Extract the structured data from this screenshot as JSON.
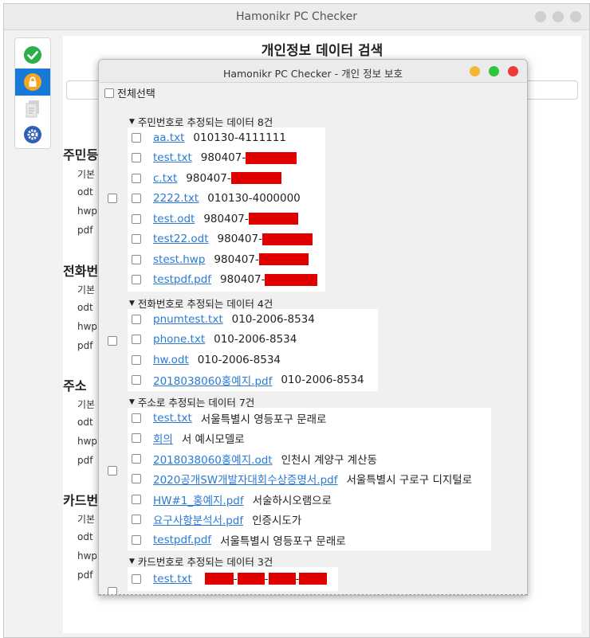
{
  "main_window": {
    "title": "Hamonikr PC Checker",
    "content_title": "개인정보 데이터 검색",
    "sections": [
      {
        "title": "주민등",
        "items": [
          "기본",
          "odt",
          "hwp",
          "pdf"
        ]
      },
      {
        "title": "전화번",
        "items": [
          "기본",
          "odt",
          "hwp",
          "pdf"
        ]
      },
      {
        "title": "주소",
        "items": [
          "기본",
          "odt",
          "hwp",
          "pdf"
        ]
      },
      {
        "title": "카드번",
        "items": [
          "기본",
          "odt",
          "hwp",
          "pdf"
        ]
      }
    ],
    "sidebar": [
      "check-icon",
      "lock-icon",
      "document-icon",
      "gear-icon"
    ]
  },
  "dialog": {
    "title": "Hamonikr PC Checker - 개인 정보 보호",
    "select_all": "전체선택",
    "groups": [
      {
        "header": "주민번호로 추정되는 데이터 8건",
        "rows": [
          {
            "file": "aa.txt",
            "value": "010130-4111111",
            "redacted": false
          },
          {
            "file": "test.txt",
            "value": "980407-",
            "redacted": true
          },
          {
            "file": "c.txt",
            "value": "980407-",
            "redacted": true
          },
          {
            "file": "2222.txt",
            "value": "010130-4000000",
            "redacted": false
          },
          {
            "file": "test.odt",
            "value": "980407-",
            "redacted": true
          },
          {
            "file": "test22.odt",
            "value": "980407-",
            "redacted": true
          },
          {
            "file": "stest.hwp",
            "value": "980407-",
            "redacted": true
          },
          {
            "file": "testpdf.pdf",
            "value": "980407-",
            "redacted": true
          }
        ]
      },
      {
        "header": "전화번호로 추정되는 데이터 4건",
        "rows": [
          {
            "file": "pnumtest.txt",
            "value": "010-2006-8534"
          },
          {
            "file": "phone.txt",
            "value": "010-2006-8534"
          },
          {
            "file": "hw.odt",
            "value": "010-2006-8534"
          },
          {
            "file": "2018038060홍예지.pdf",
            "value": "010-2006-8534"
          }
        ]
      },
      {
        "header": "주소로 추정되는 데이터 7건",
        "rows": [
          {
            "file": "test.txt",
            "value": "서울특별시 영등포구 문래로"
          },
          {
            "file": "회의",
            "value": "서 예시모델로"
          },
          {
            "file": "2018038060홍예지.odt",
            "value": "인천시 계양구 계산동"
          },
          {
            "file": "2020공개SW개발자대회수상증명서.pdf",
            "value": "서울특별시 구로구 디지털로"
          },
          {
            "file": "HW#1_홍예지.pdf",
            "value": "서술하시오램으로"
          },
          {
            "file": "요구사항분석서.pdf",
            "value": "인증시도가"
          },
          {
            "file": "testpdf.pdf",
            "value": "서울특별시 영등포구 문래로"
          }
        ]
      },
      {
        "header": "카드번호로 추정되는 데이터 3건",
        "rows": [
          {
            "file": "test.txt",
            "value": "",
            "card_redacted": true
          }
        ]
      }
    ]
  },
  "colors": {
    "link": "#2a7ad5",
    "redaction": "#e00000",
    "sidebar_active": "#1779d8",
    "traffic_yellow": "#f5b731",
    "traffic_green": "#2fc53f",
    "traffic_red": "#ec3b36"
  }
}
